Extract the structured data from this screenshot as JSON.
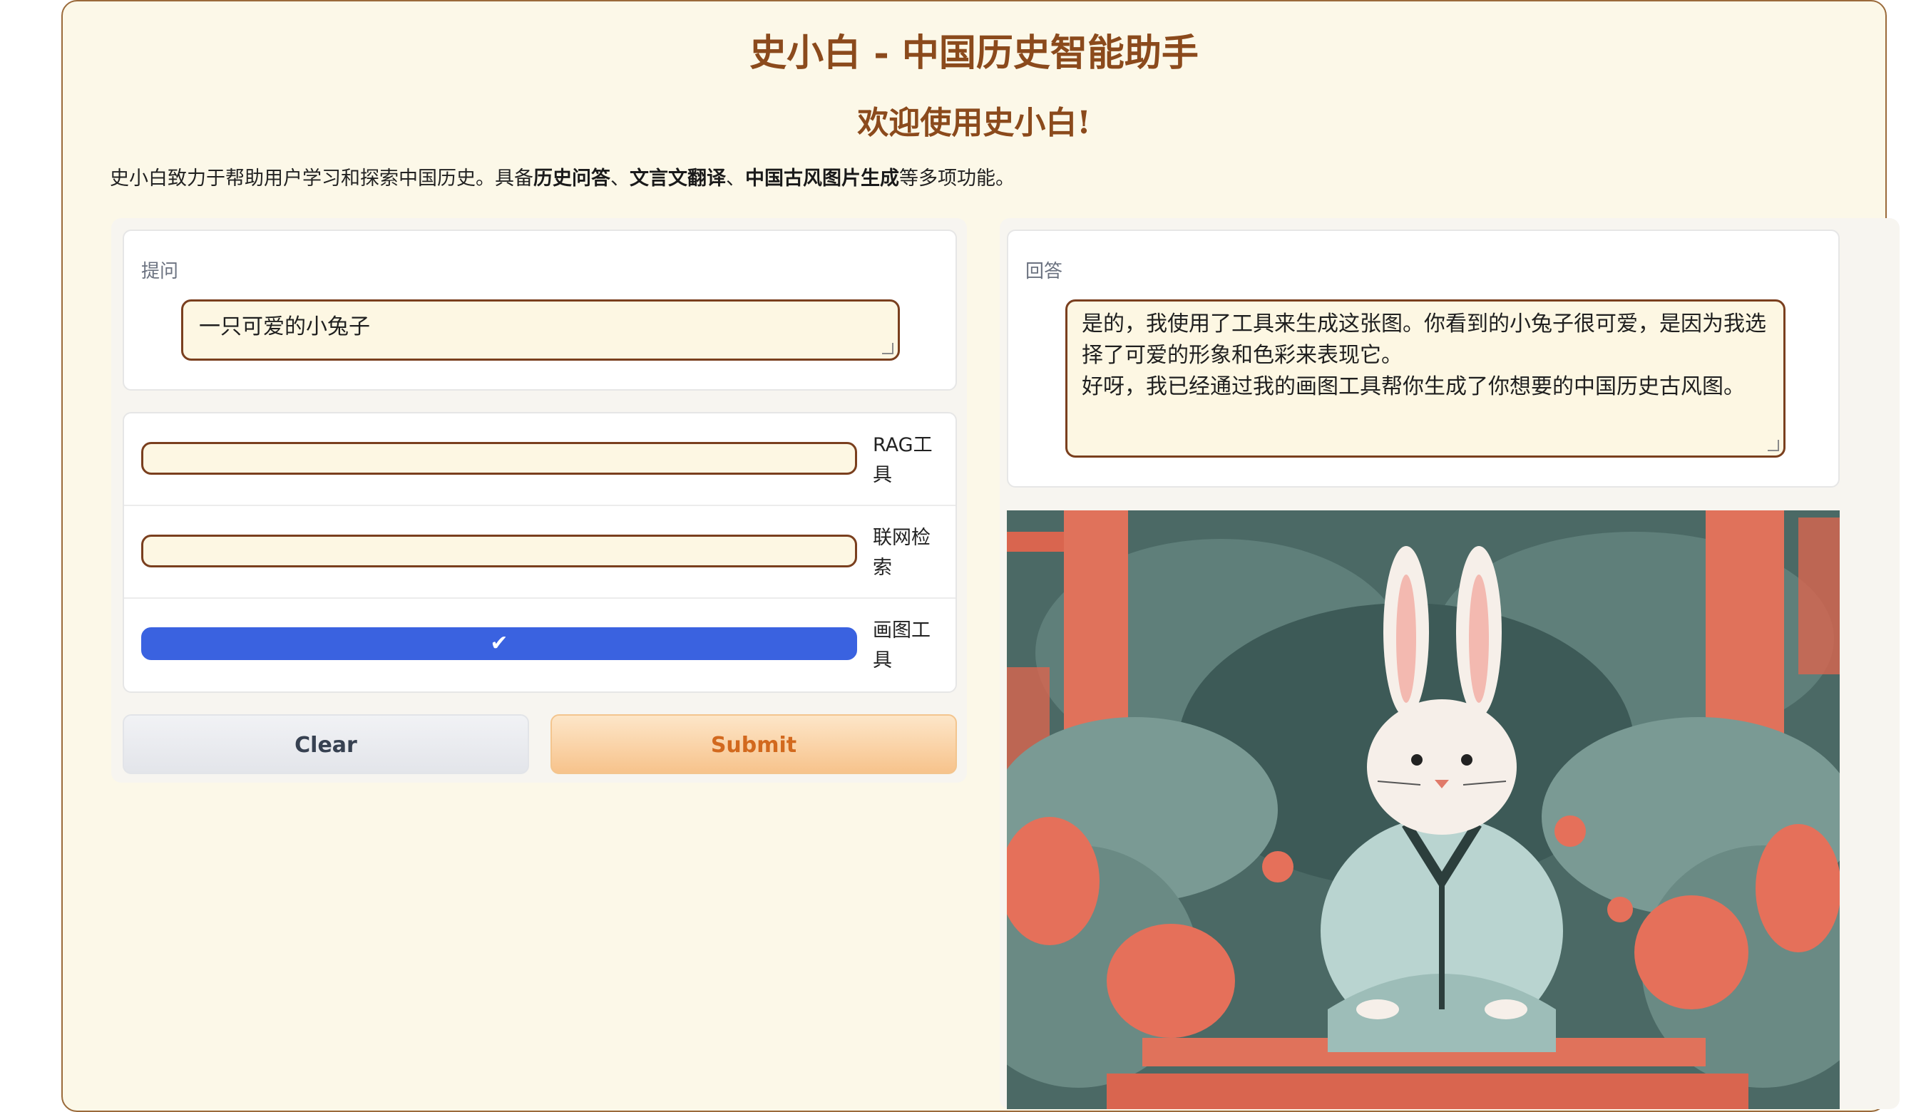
{
  "header": {
    "title": "史小白 - 中国历史智能助手",
    "subtitle": "欢迎使用史小白!",
    "description": {
      "prefix": "史小白致力于帮助用户学习和探索中国历史。具备",
      "feature1": "历史问答",
      "sep1": "、",
      "feature2": "文言文翻译",
      "sep2": "、",
      "feature3": "中国古风图片生成",
      "suffix": "等多项功能。"
    }
  },
  "question": {
    "label": "提问",
    "value": "一只可爱的小兔子"
  },
  "tools": [
    {
      "label": "RAG工具",
      "checked": false
    },
    {
      "label": "联网检索",
      "checked": false
    },
    {
      "label": "画图工具",
      "checked": true
    }
  ],
  "buttons": {
    "clear": "Clear",
    "submit": "Submit"
  },
  "answer": {
    "label": "回答",
    "line1": "是的，我使用了工具来生成这张图。你看到的小兔子很可爱，是因为我选择了可爱的形象和色彩来表现它。",
    "line2": "好呀，我已经通过我的画图工具帮你生成了你想要的中国历史古风图。"
  },
  "colors": {
    "page_bg": "#fcf8e8",
    "accent_brown": "#8b4a1c",
    "checkbox_on": "#3a62e0",
    "submit_text": "#d2691e"
  },
  "check_icon": "check-icon"
}
